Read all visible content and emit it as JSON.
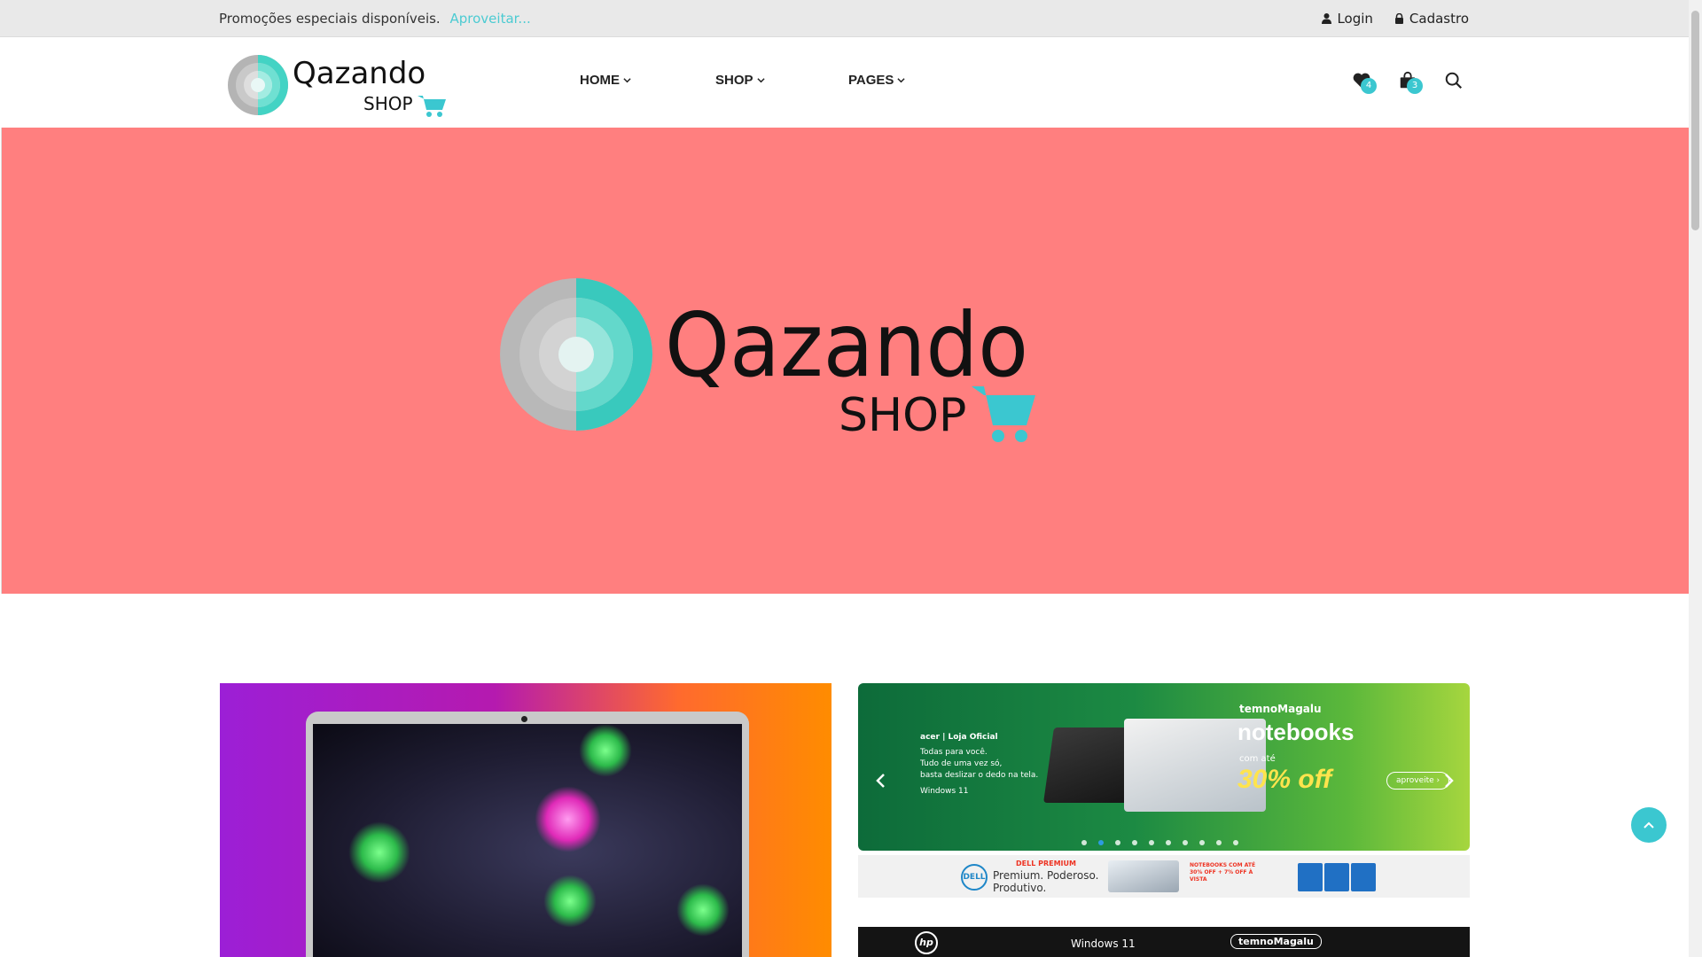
{
  "topbar": {
    "promo_text": "Promoções especiais disponíveis.",
    "promo_link": "Aproveitar...",
    "login": "Login",
    "signup": "Cadastro"
  },
  "header": {
    "logo_text_top": "Qazando",
    "logo_text_bottom": "SHOP",
    "nav": [
      {
        "label": "HOME"
      },
      {
        "label": "SHOP"
      },
      {
        "label": "PAGES"
      }
    ],
    "wishlist_count": "4",
    "cart_count": "3"
  },
  "hero": {
    "logo_text_top": "Qazando",
    "logo_text_bottom": "SHOP",
    "background": "#ff7f7f"
  },
  "banner_right": {
    "brand_small": "acer | Loja Oficial",
    "tagline_lines": [
      "Todas para você.",
      "Tudo de uma vez só,",
      "basta deslizar o dedo na tela."
    ],
    "os": "Windows 11",
    "store": "temnoMagalu",
    "headline": "notebooks",
    "subline": "com até",
    "discount": "30% off",
    "cta": "aproveite ›",
    "dots_count": 10,
    "active_dot": 1
  },
  "banner_dell": {
    "tag": "DELL PREMIUM",
    "line1": "Premium. Poderoso.",
    "line2": "Produtivo.",
    "promo": "NOTEBOOKS COM ATÉ 30% OFF + 7% OFF À VISTA",
    "logo": "DELL"
  },
  "banner_hp": {
    "logo": "hp",
    "os": "Windows 11",
    "store": "temnoMagalu"
  },
  "colors": {
    "accent": "#3bc7d0",
    "hero_bg": "#ff7f7f",
    "topbar_bg": "#e9e9e9"
  }
}
